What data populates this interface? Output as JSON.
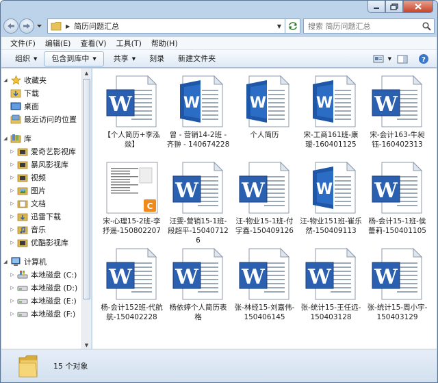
{
  "address": {
    "path": "简历问题汇总"
  },
  "search": {
    "placeholder": "搜索 简历问题汇总"
  },
  "menu": [
    "文件(F)",
    "编辑(E)",
    "查看(V)",
    "工具(T)",
    "帮助(H)"
  ],
  "toolbar": {
    "organize": "组织",
    "include_library": "包含到库中",
    "share": "共享",
    "burn": "刻录",
    "new_folder": "新建文件夹"
  },
  "nav": {
    "favorites": {
      "label": "收藏夹",
      "items": [
        "下载",
        "桌面",
        "最近访问的位置"
      ]
    },
    "libraries": {
      "label": "库",
      "items": [
        "爱奇艺影视库",
        "暴风影视库",
        "视频",
        "图片",
        "文档",
        "迅雷下载",
        "音乐",
        "优酷影视库"
      ]
    },
    "computer": {
      "label": "计算机",
      "items": [
        "本地磁盘 (C:)",
        "本地磁盘 (D:)",
        "本地磁盘 (E:)",
        "本地磁盘 (F:)"
      ]
    }
  },
  "files": [
    {
      "name": "【个人简历+李泓燚】",
      "icon": "word-doc-large"
    },
    {
      "name": "曾 - 营销14-2班 - 齐翀 - 140674228",
      "icon": "word-docx"
    },
    {
      "name": "个人简历",
      "icon": "word-docx"
    },
    {
      "name": "宋-工商161班-康瑷-160401125",
      "icon": "word-docx"
    },
    {
      "name": "宋-会计163-牛昶钰-160402313",
      "icon": "word-doc-large"
    },
    {
      "name": "宋-心理15-2班-李抒遥-150802207",
      "icon": "document-preview"
    },
    {
      "name": "汪雯-营销15-1班-段超平-150407126",
      "icon": "word-doc-large"
    },
    {
      "name": "汪-物业15-1班-付宇鑫-150409126",
      "icon": "word-doc-large"
    },
    {
      "name": "汪-物业151班-崔乐然-150409113",
      "icon": "word-docx"
    },
    {
      "name": "杨-会计15-1班-侯蕾莉-150401105",
      "icon": "word-doc-large"
    },
    {
      "name": "杨-会计152班-代航航-150402228",
      "icon": "word-doc-large"
    },
    {
      "name": "杨依婷个人简历表格",
      "icon": "word-doc-large"
    },
    {
      "name": "张-林经15-刘嘉伟-150406145",
      "icon": "word-doc-large"
    },
    {
      "name": "张-统计15-王任远-150403128",
      "icon": "word-doc-large"
    },
    {
      "name": "张-统计15-周小宇-150403129",
      "icon": "word-doc-large"
    }
  ],
  "status": {
    "count": "15 个对象"
  }
}
